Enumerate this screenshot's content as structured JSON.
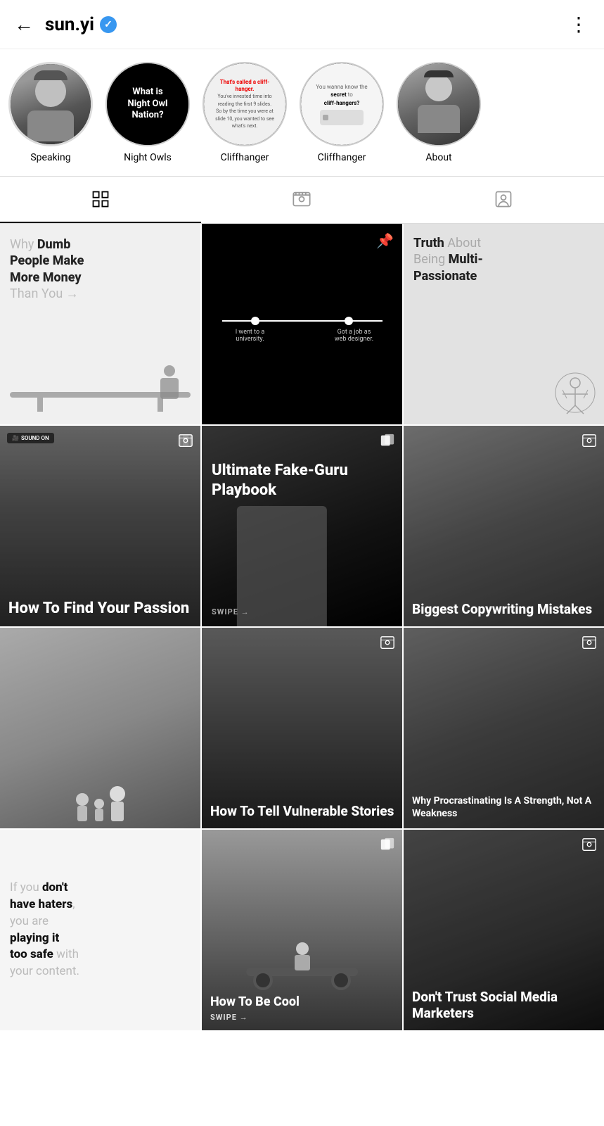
{
  "header": {
    "back_label": "←",
    "username": "sun.yi",
    "more_label": "⋮",
    "verified": true
  },
  "stories": {
    "items": [
      {
        "id": "speaking",
        "label": "Speaking",
        "type": "photo"
      },
      {
        "id": "night_owls",
        "label": "Night Owls",
        "type": "text",
        "line1": "What is",
        "line2": "Night Owl",
        "line3": "Nation?"
      },
      {
        "id": "cliffhanger1",
        "label": "Cliffhanger",
        "type": "text_slide"
      },
      {
        "id": "cliffhanger2",
        "label": "Cliffhanger",
        "type": "text_slide2"
      },
      {
        "id": "about",
        "label": "About",
        "type": "photo2"
      }
    ]
  },
  "tabs": {
    "grid_label": "Grid",
    "reels_label": "Reels",
    "tagged_label": "Tagged"
  },
  "grid": {
    "posts": [
      {
        "id": 1,
        "type": "text_white_bg",
        "title_gray": "Why",
        "title_black": "Dumb People Make More Money",
        "title_gray2": "Than You →",
        "has_carousel": false
      },
      {
        "id": 2,
        "type": "black_timeline",
        "pinned": true,
        "timeline_left": "I went to a university.",
        "timeline_right": "Got a job as web designer."
      },
      {
        "id": 3,
        "type": "text_gray_bg",
        "title_black": "Truth",
        "title_gray": "About Being",
        "title_black2": "Multi-Passionate"
      },
      {
        "id": 4,
        "type": "video_dark",
        "sound_on": "SOUND ON",
        "title": "How To Find Your Passion",
        "has_reel": true
      },
      {
        "id": 5,
        "type": "text_black_bg",
        "title": "Ultimate Fake-Guru Playbook",
        "swipe": "SWIPE →",
        "has_carousel": true
      },
      {
        "id": 6,
        "type": "video_glasses",
        "title": "Biggest Copywriting Mistakes",
        "has_reel": true
      },
      {
        "id": 7,
        "type": "photo_family",
        "title": ""
      },
      {
        "id": 8,
        "type": "video_hug",
        "title": "How To Tell Vulnerable Stories",
        "has_reel": true
      },
      {
        "id": 9,
        "type": "video_thinking",
        "title": "Why Procrastinating Is A Strength, Not A Weakness",
        "has_reel": true
      },
      {
        "id": 10,
        "type": "text_white_bg2",
        "title_gray": "If you",
        "title_black": "don't have haters",
        "title_gray2": ", you are",
        "title_black2": "playing it too safe",
        "title_gray3": " with your content."
      },
      {
        "id": 11,
        "type": "photo_cool",
        "title": "How To Be Cool",
        "swipe": "SWIPE →",
        "has_carousel": true
      },
      {
        "id": 12,
        "type": "video_social",
        "title": "Don't Trust Social Media Marketers",
        "has_reel": true
      }
    ]
  }
}
